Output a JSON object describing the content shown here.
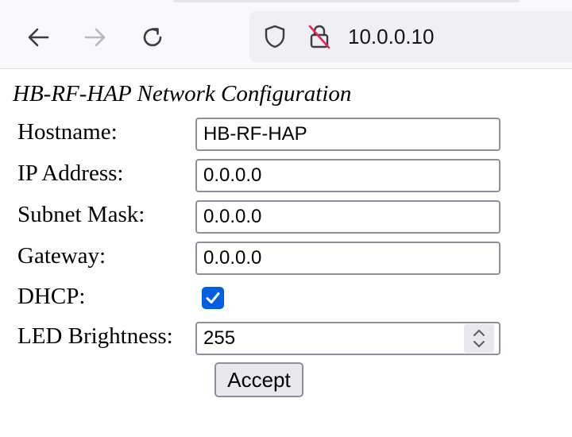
{
  "browser": {
    "url": "10.0.0.10",
    "icons": {
      "back": "arrow-left-icon",
      "forward": "arrow-right-icon",
      "reload": "reload-icon",
      "tracking": "shield-icon",
      "security": "insecure-lock-icon"
    }
  },
  "page": {
    "title": "HB-RF-HAP Network Configuration",
    "fields": {
      "hostname": {
        "label": "Hostname:",
        "value": "HB-RF-HAP"
      },
      "ip": {
        "label": "IP Address:",
        "value": "0.0.0.0"
      },
      "netmask": {
        "label": "Subnet Mask:",
        "value": "0.0.0.0"
      },
      "gateway": {
        "label": "Gateway:",
        "value": "0.0.0.0"
      },
      "dhcp": {
        "label": "DHCP:",
        "checked": true
      },
      "led": {
        "label": "LED Brightness:",
        "value": "255"
      }
    },
    "accept_label": "Accept"
  },
  "colors": {
    "checkbox_accent": "#0060df",
    "input_border": "#8f8f9d",
    "toolbar_bg": "#f9f9fb",
    "urlbar_bg": "#f0f0f4"
  }
}
